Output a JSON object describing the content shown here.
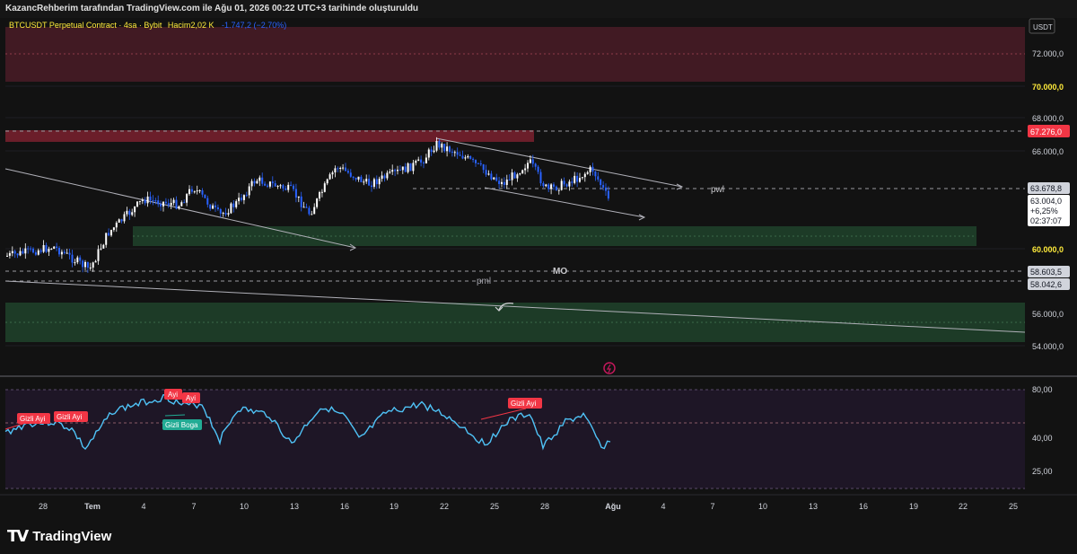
{
  "header": {
    "caption": "KazancRehberim tarafından TradingView.com ile Ağu 01, 2026 00:22 UTC+3 tarihinde oluşturuldu"
  },
  "symbol_info": {
    "symbol": "BTCUSDT Perpetual Contract · 4sa · Bybit",
    "volume_label": "Hacim",
    "volume_value": "2,02 K",
    "change": "-1.747,2 (−2,70%)"
  },
  "price_axis": {
    "currency": "USDT",
    "labels": [
      "72.000,0",
      "70.000,0",
      "68.000,0",
      "66.000,0",
      "60.000,0",
      "56.000,0",
      "54.000,0"
    ],
    "badge_resistance": "67.276,0",
    "badge_pwl": "63.678,8",
    "current_price": "63.004,0",
    "current_change": "+6,25%",
    "countdown": "02:37:07",
    "badge_mo": "58.603,5",
    "badge_pml": "58.042,6"
  },
  "annotations": {
    "pwl": "pwl",
    "mo": "MO",
    "pml": "pml"
  },
  "rsi": {
    "axis_labels": [
      "80,00",
      "40,00",
      "25,00"
    ],
    "signals": [
      "Gizli Ayi",
      "Gizli Ayi",
      "Ayi",
      "Ayi",
      "Gizli Boga",
      "Gizli Ayi"
    ]
  },
  "time_axis": {
    "labels": [
      "28",
      "Tem",
      "4",
      "7",
      "10",
      "13",
      "16",
      "19",
      "22",
      "25",
      "28",
      "Ağu",
      "4",
      "7",
      "10",
      "13",
      "16",
      "19",
      "22",
      "25"
    ]
  },
  "branding": {
    "name": "TradingView",
    "mark": "TV"
  },
  "colors": {
    "bg": "#121212",
    "candle_up": "#ffffff",
    "candle_down": "#2962ff",
    "rsi_line": "#4fc3f7",
    "zone_red": "#4a1c27",
    "zone_green": "#1d3b27",
    "badge_red": "#f23645",
    "badge_green": "#22ab94"
  },
  "icons": [
    "lightning-icon",
    "alert-arrow-icon"
  ]
}
